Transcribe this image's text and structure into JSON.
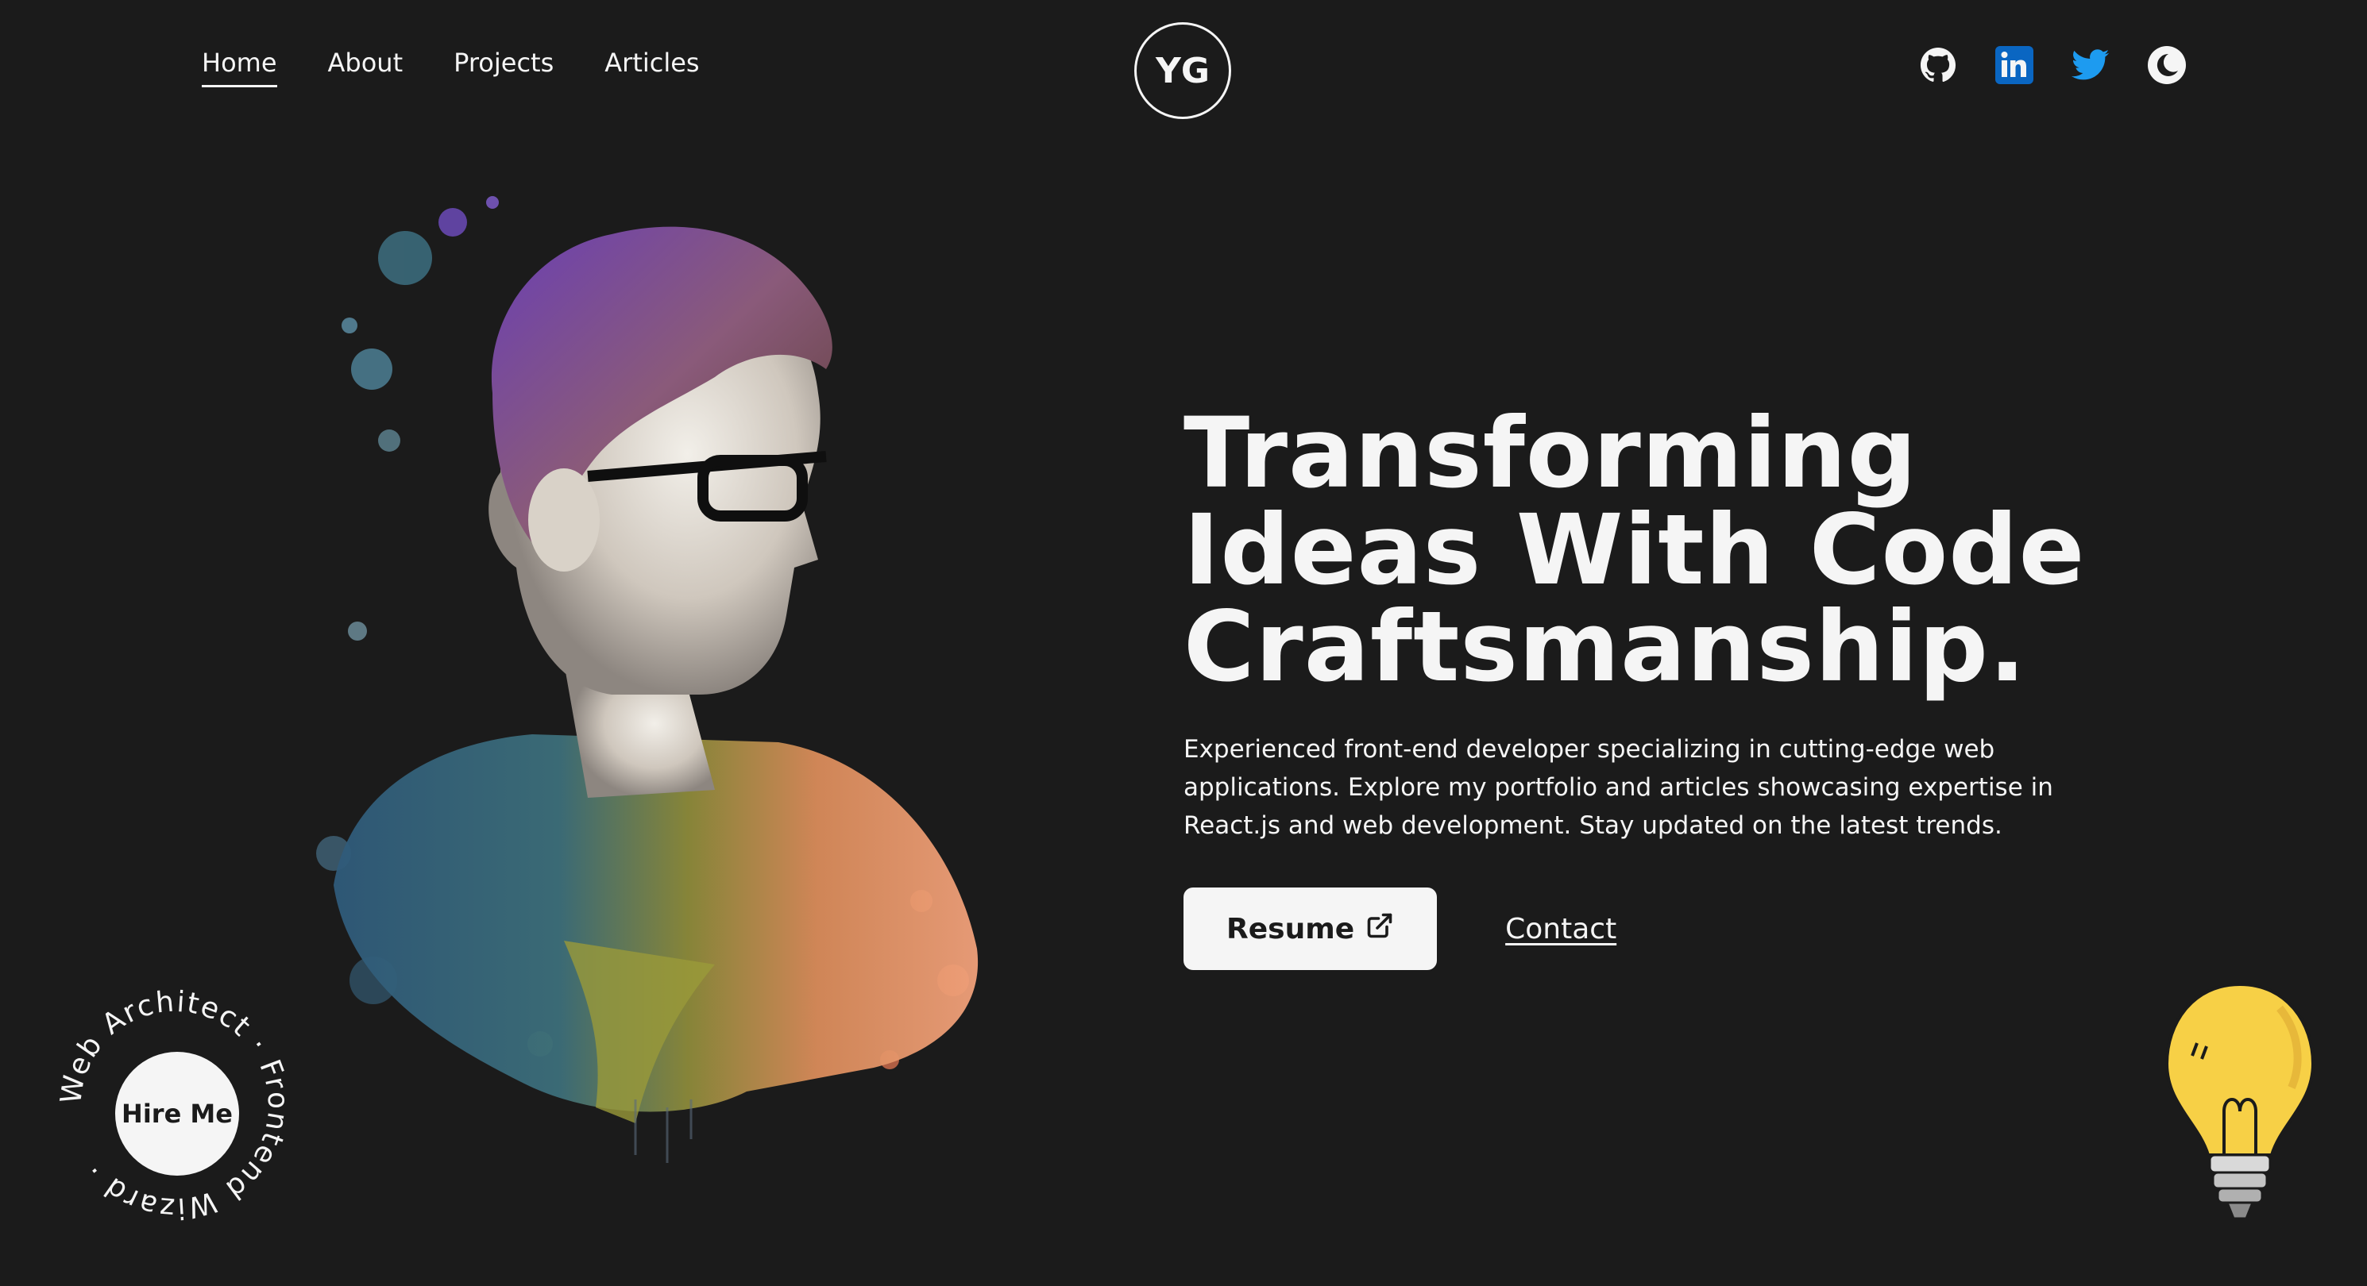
{
  "nav": {
    "links": [
      {
        "label": "Home",
        "active": true
      },
      {
        "label": "About",
        "active": false
      },
      {
        "label": "Projects",
        "active": false
      },
      {
        "label": "Articles",
        "active": false
      }
    ],
    "logo": "YG"
  },
  "socials": [
    "github-icon",
    "linkedin-icon",
    "twitter-icon",
    "theme-toggle-icon"
  ],
  "colors": {
    "background": "#1b1b1b",
    "foreground": "#f5f5f5",
    "linkedin": "#0a66c2",
    "twitter": "#1d9bf0",
    "bulb": "#f7d046"
  },
  "hero": {
    "headline": [
      "Transforming",
      "Ideas With Code",
      "Craftsmanship."
    ],
    "description": "Experienced front-end developer specializing in cutting-edge web applications. Explore my portfolio and articles showcasing expertise in React.js and web development. Stay updated on the latest trends.",
    "resume_label": "Resume",
    "contact_label": "Contact"
  },
  "badge": {
    "center_label": "Hire Me",
    "ring_text": "Web Architect · Frontend Wizard · "
  }
}
